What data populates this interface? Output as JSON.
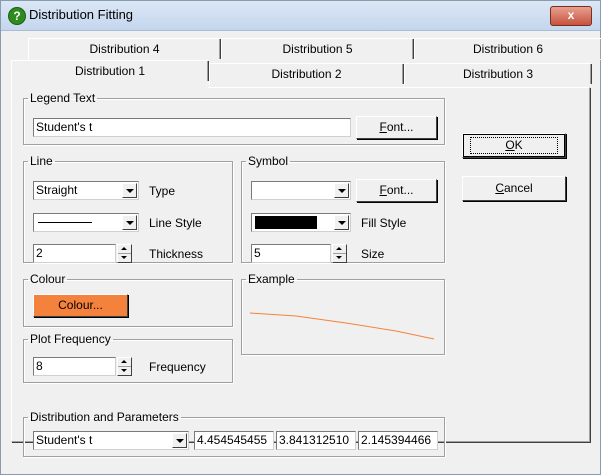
{
  "window": {
    "title": "Distribution Fitting",
    "close_label": "x"
  },
  "tabs_back": [
    {
      "label": "Distribution 4"
    },
    {
      "label": "Distribution 5"
    },
    {
      "label": "Distribution 6"
    }
  ],
  "tabs_front": [
    {
      "label": "Distribution 1"
    },
    {
      "label": "Distribution 2"
    },
    {
      "label": "Distribution 3"
    }
  ],
  "legend_text": {
    "group": "Legend Text",
    "value": "Student's t",
    "font_button_u": "F",
    "font_button_rest": "ont..."
  },
  "line": {
    "group": "Line",
    "type_value": "Straight",
    "type_label": "Type",
    "style_label": "Line Style",
    "thickness_value": "2",
    "thickness_label": "Thickness"
  },
  "symbol": {
    "group": "Symbol",
    "value": "",
    "font_button_u": "F",
    "font_button_rest": "ont...",
    "fill_label": "Fill Style",
    "size_value": "5",
    "size_label": "Size"
  },
  "colour": {
    "group": "Colour",
    "button_label": "Colour...",
    "button_color": "#f5823c"
  },
  "example": {
    "group": "Example",
    "line_color": "#f5823c"
  },
  "plot_frequency": {
    "group": "Plot Frequency",
    "value": "8",
    "label": "Frequency"
  },
  "distribution": {
    "group": "Distribution and Parameters",
    "selected": "Student's t",
    "params": [
      "4.454545455",
      "3.841312510",
      "2.145394466"
    ]
  },
  "buttons": {
    "ok_u": "O",
    "ok_rest": "K",
    "cancel_u": "C",
    "cancel_rest": "ancel"
  }
}
